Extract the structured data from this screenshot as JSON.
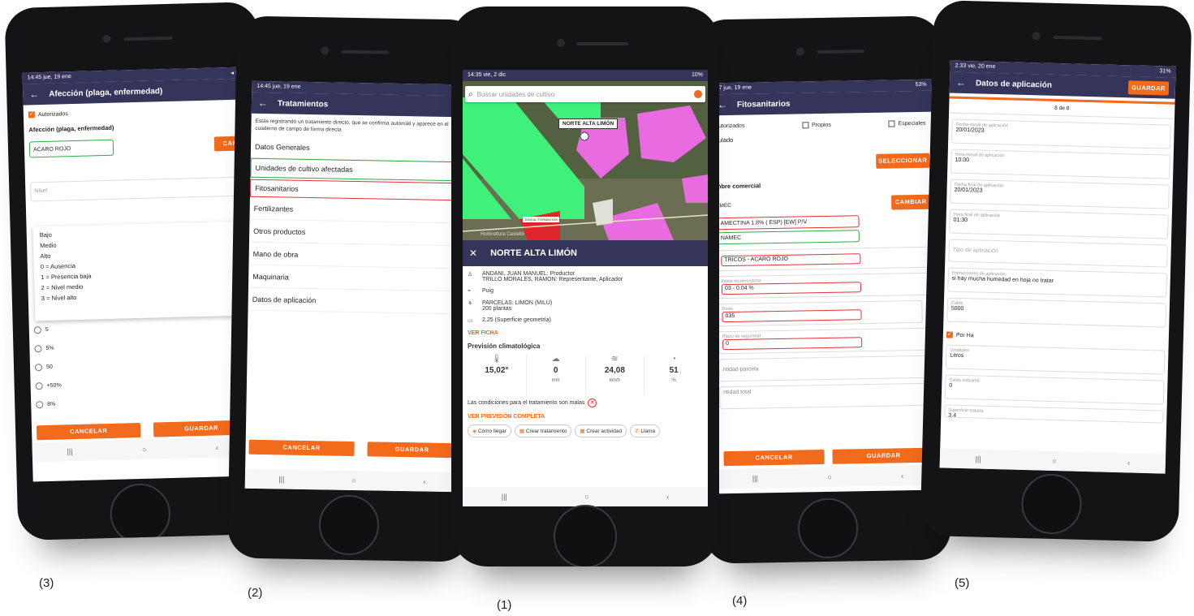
{
  "captions": [
    "(3)",
    "(2)",
    "(1)",
    "(4)",
    "(5)"
  ],
  "colors": {
    "accent": "#f26a1b",
    "header": "#35345a",
    "red_outline": "#e0303a",
    "green_outline": "#2daa4a"
  },
  "p3": {
    "status_left": "14:45 jue, 19 ene",
    "title": "Afección (plaga, enfermedad)",
    "checkbox_label": "Autorizados",
    "field_label": "Afección (plaga, enfermedad)",
    "field_value": "ACARO ROJO",
    "change_btn": "CAM",
    "nivel_placeholder": "Nivel",
    "dropdown": [
      "Bajo",
      "Medio",
      "Alto",
      "0 = Ausencia",
      "1 = Presencia baja",
      "2 = Nivel medio",
      "3 = Nivel alto"
    ],
    "radios": [
      "5",
      "5%",
      "50",
      "+50%",
      "8%"
    ],
    "cancel": "CANCELAR",
    "save": "GUARDAR"
  },
  "p2": {
    "status_left": "14:45 jue, 19 ene",
    "title": "Tratamientos",
    "intro": "Estás registrando un tratamiento directo, que se confirma automáti y aparece en el cuaderno de campo de forma directa",
    "menu": [
      "Datos Generales",
      "Unidades de cultivo afectadas",
      "Fitosanitarios",
      "Fertilizantes",
      "Otros productos",
      "Mano de obra",
      "Maquinaria",
      "Datos de aplicación"
    ],
    "cancel": "CANCELAR",
    "save": "GUARDAR"
  },
  "p1": {
    "status_left": "14:35 vie, 2 dic",
    "status_right": "10%",
    "search_placeholder": "Buscar unidades de cultivo",
    "map_label": "NORTE ALTA LIMÓN",
    "map_small_label": "JUNCAL FORMACIÓN",
    "map_credit": "Horticultura Castelló",
    "sheet_title": "NORTE ALTA LIMÓN",
    "people_line1": "ANDANI, JUAN MANUEL: Productor",
    "people_line2": "TRILLO MORALES, RAMON: Representante, Aplicador",
    "place": "Puig",
    "parcel_line1": "PARCELAS: LIMON (MILU)",
    "parcel_line2": "200 plantas",
    "surface": "2,25 (Superficie geometría)",
    "ver_ficha": "VER FICHA",
    "forecast_title": "Previsión climatológica",
    "weather": [
      {
        "icon": "thermometer-icon",
        "value": "15,02°",
        "unit": ""
      },
      {
        "icon": "rain-cloud-icon",
        "value": "0",
        "unit": "mm"
      },
      {
        "icon": "wind-icon",
        "value": "24,08",
        "unit": "km/h"
      },
      {
        "icon": "humidity-icon",
        "value": "51",
        "unit": "%"
      }
    ],
    "conditions": "Las condiciones para el tratamiento son malas",
    "ver_prevision": "VER PREVISIÓN COMPLETA",
    "actions": [
      "Cómo llegar",
      "Crear tratamiento",
      "Crear actividad",
      "Llama"
    ]
  },
  "p4": {
    "status_left": "47 jue, 19 ene",
    "status_right": "53%",
    "title": "Fitosanitarios",
    "checks": [
      "Autorizados",
      "Propios",
      "Especiales"
    ],
    "anulado": "nulado",
    "select_btn": "SELECCIONAR",
    "nombre_label": "mbre comercial",
    "amec": "AMEC",
    "change_btn": "CAMBIAR",
    "fields": [
      {
        "label": "",
        "value": "AMECTINA 1,8% ( ESP) [EW] P/V",
        "style": "red"
      },
      {
        "label": "",
        "value": "NAMEC",
        "style": "green"
      },
      {
        "label": "",
        "value": "TRICOS - ACARO ROJO",
        "style": "red"
      },
      {
        "label": "Dosis recomendada",
        "value": "03 - 0.04 %",
        "style": "red"
      },
      {
        "label": "Dosis",
        "value": "035",
        "style": "red"
      },
      {
        "label": "Plazo de seguridad",
        "value": "0",
        "style": "red"
      },
      {
        "label": "",
        "value": "ntidad parcela",
        "style": "plain"
      },
      {
        "label": "",
        "value": "ntidad total",
        "style": "plain"
      }
    ],
    "percent": "%",
    "cancel": "CANCELAR",
    "save": "GUARDAR"
  },
  "p5": {
    "status_left": "2:33 vie, 20 ene",
    "status_right": "31%",
    "title": "Datos de aplicación",
    "save": "GUARDAR",
    "step": "8 de 8",
    "fields": [
      {
        "label": "Fecha inicial de aplicación",
        "value": "20/01/2023"
      },
      {
        "label": "Hora inicial de aplicación",
        "value": "10:00"
      },
      {
        "label": "Fecha final de aplicación",
        "value": "20/01/2023"
      },
      {
        "label": "Hora final de aplicación",
        "value": "01:30"
      },
      {
        "label": "",
        "value": "Tipo de aplicación"
      },
      {
        "label": "Instrucciones de aplicación",
        "value": "si hay mucha humedad en hoja no tratar"
      },
      {
        "label": "Caldo",
        "value": "5000"
      }
    ],
    "por_ha": "Por Ha",
    "fields2": [
      {
        "label": "Unidades",
        "value": "Litros"
      },
      {
        "label": "Caldo sobrante",
        "value": "0"
      },
      {
        "label": "Superficie tratada",
        "value": "3,4"
      }
    ]
  }
}
